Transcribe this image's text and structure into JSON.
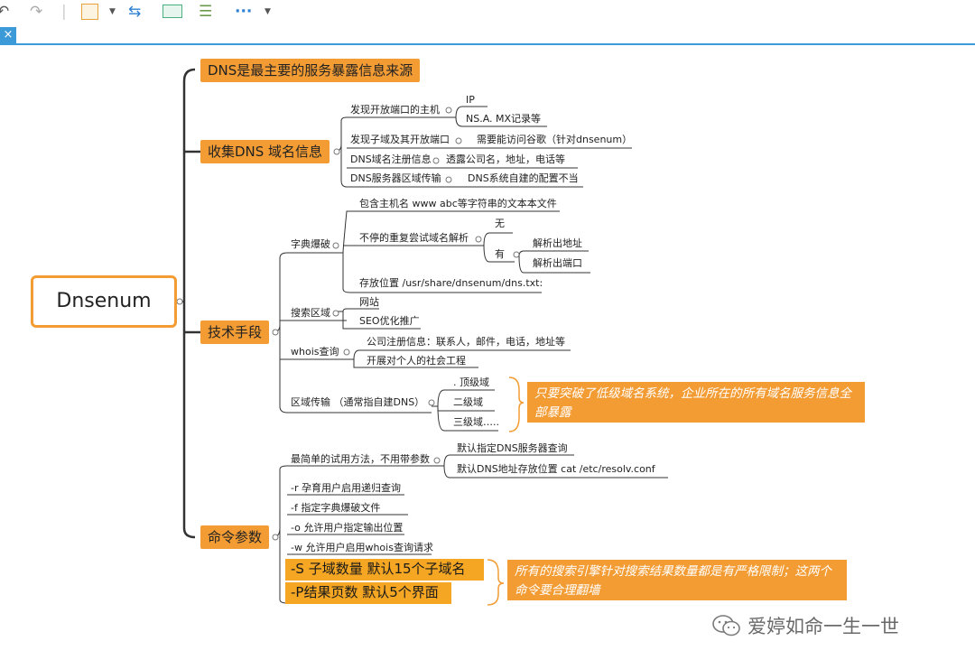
{
  "colors": {
    "accent": "#f39c34",
    "tab_underline": "#3c9ad9",
    "line": "#333333"
  },
  "toolbar": {
    "icons": [
      "undo-icon",
      "redo-icon",
      "save-icon",
      "dropdown-arrow-icon",
      "link-icon",
      "map-icon",
      "outline-icon",
      "more-icon",
      "dropdown-arrow-icon"
    ],
    "close_label": "×"
  },
  "root": {
    "label": "Dnsenum"
  },
  "b1": {
    "label": "DNS是最主要的服务暴露信息来源"
  },
  "b2": {
    "label": "收集DNS 域名信息",
    "items": [
      "发现开放端口的主机",
      "IP",
      "NS.A. MX记录等",
      "发现子域及其开放端口",
      "需要能访问谷歌（针对dnsenum）",
      "DNS域名注册信息",
      "透露公司名，地址，电话等",
      "DNS服务器区域传输",
      "DNS系统自建的配置不当"
    ]
  },
  "b3": {
    "label": "技术手段",
    "dict": {
      "label": "字典爆破",
      "items": [
        "包含主机名 www abc等字符串的文本本文件",
        "不停的重复尝试域名解析",
        "无",
        "有",
        "解析出地址",
        "解析出端口",
        "存放位置 /usr/share/dnsenum/dns.txt:"
      ]
    },
    "search": {
      "label": "搜索区域",
      "items": [
        "网站",
        "SEO优化推广"
      ]
    },
    "whois": {
      "label": "whois查询",
      "items": [
        "公司注册信息：联系人，邮件，电话，地址等",
        "开展对个人的社会工程"
      ]
    },
    "zone": {
      "label": "区域传输 （通常指自建DNS）",
      "items": [
        ". 顶级域",
        "二级域",
        "三级域….."
      ]
    },
    "note": "只要突破了低级域名系统，企业所在的所有域名服务信息全部暴露"
  },
  "b4": {
    "label": "命令参数",
    "simple": {
      "label": "最简单的试用方法，不用带参数",
      "items": [
        "默认指定DNS服务器查询",
        "默认DNS地址存放位置 cat /etc/resolv.conf"
      ]
    },
    "flags": [
      "-r 孕育用户启用递归查询",
      "-f 指定字典爆破文件",
      "-o 允许用户指定输出位置",
      "-w 允许用户启用whois查询请求"
    ],
    "big": [
      "-S 子域数量  默认15个子域名",
      "-P结果页数 默认5个界面"
    ],
    "note": "所有的搜索引擎针对搜索结果数量都是有严格限制；这两个命令要合理翻墙"
  },
  "watermark": {
    "text": "爱婷如命一生一世"
  }
}
